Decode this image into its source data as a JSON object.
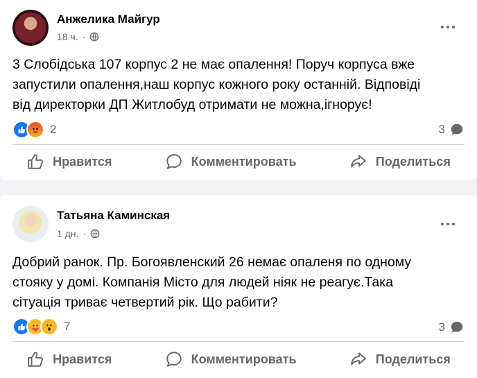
{
  "posts": [
    {
      "author": "Анжелика Майгур",
      "time": "18 ч.",
      "text": "3 Слобідська 107 корпус 2 не має опалення! Поруч корпуса вже\nзапустили опалення,наш корпус кожного року останній. Відповіді\nвід директорки ДП Житлобуд отримати не можна,ігнорує!",
      "reactions": [
        "like",
        "angry"
      ],
      "reaction_count": "2",
      "comment_count": "3",
      "actions": {
        "like": "Нравится",
        "comment": "Комментировать",
        "share": "Поделиться"
      }
    },
    {
      "author": "Татьяна Каминская",
      "time": "1 дн.",
      "text": "Добрий ранок. Пр. Богоявленский 26 немає опаленя по одному\nстояку у домі. Компанія  Місто для людей ніяк не реагує.Така\nсітуація триває четвертий рік. Що рабити?",
      "reactions": [
        "like",
        "care",
        "wow"
      ],
      "reaction_count": "7",
      "comment_count": "3",
      "actions": {
        "like": "Нравится",
        "comment": "Комментировать",
        "share": "Поделиться"
      }
    }
  ],
  "colors": {
    "accent": "#1877f2",
    "muted": "#65676b",
    "background": "#f0f2f5"
  }
}
